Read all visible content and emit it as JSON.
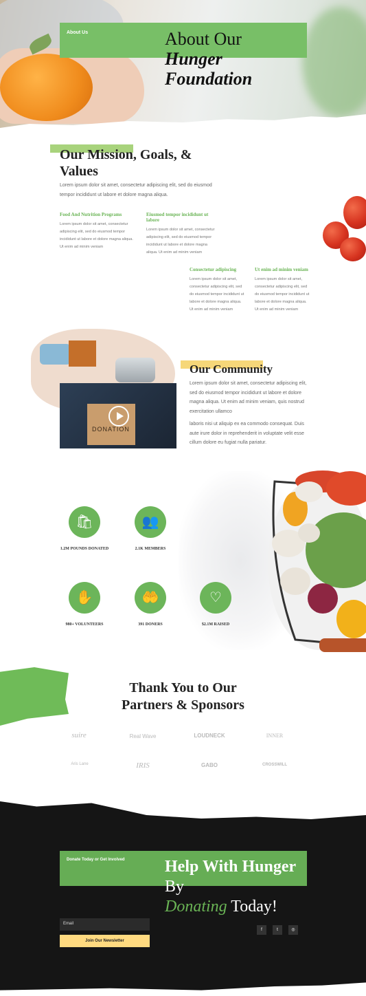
{
  "hero": {
    "kicker": "About Us",
    "title_line1": "About Our",
    "title_bold": "Hunger Foundation"
  },
  "mission": {
    "title": "Our Mission, Goals, & Values",
    "body": "Lorem ipsum dolor sit amet, consectetur adipiscing elit, sed do eiusmod tempor incididunt ut labore et dolore magna aliqua.",
    "columns": [
      {
        "heading": "Food And Nutrition Programs",
        "body": "Lorem ipsum dolor sit amet, consectetur adipiscing elit, sed do eiusmod tempor incididunt ut labore et dolore magna aliqua. Ut enim ad minim veniam"
      },
      {
        "heading": "Eiusmod tempor incididunt ut labore",
        "body": "Lorem ipsum dolor sit amet, consectetur adipiscing elit, sed do eiusmod tempor incididunt ut labore et dolore magna aliqua. Ut enim ad minim veniam"
      },
      {
        "heading": "Consectetur adipiscing",
        "body": "Lorem ipsum dolor sit amet, consectetur adipiscing elit, sed do eiusmod tempor incididunt ut labore et dolore magna aliqua. Ut enim ad minim veniam"
      },
      {
        "heading": "Ut enim ad minim veniam",
        "body": "Lorem ipsum dolor sit amet, consectetur adipiscing elit, sed do eiusmod tempor incididunt ut labore et dolore magna aliqua. Ut enim ad minim veniam"
      }
    ]
  },
  "community": {
    "title": "Our Community",
    "p1": "Lorem ipsum dolor sit amet, consectetur adipiscing elit, sed do eiusmod tempor incididunt ut labore et dolore magna aliqua. Ut enim ad minim veniam, quis nostrud exercitation ullamco",
    "p2": "laboris nisi ut aliquip ex ea commodo consequat. Duis aute irure dolor in reprehenderit in voluptate velit esse cillum dolore eu fugiat nulla pariatur.",
    "video_box_label": "DONATION"
  },
  "stats": [
    {
      "icon": "bag-icon",
      "glyph": "🛍",
      "label": "1.2M POUNDS DONATED"
    },
    {
      "icon": "members-icon",
      "glyph": "👥",
      "label": "2.1K MEMBERS"
    },
    {
      "icon": "raised-hand-icon",
      "glyph": "✋",
      "label": "980+ VOLUNTEERS"
    },
    {
      "icon": "heart-hand-icon",
      "glyph": "🤲",
      "label": "391 DONERS"
    },
    {
      "icon": "heart-icon",
      "glyph": "♡",
      "label": "$2.1M RAISED"
    }
  ],
  "partners": {
    "title": "Thank You to Our Partners & Sponsors",
    "logos": [
      "suire",
      "Real Wave",
      "LOUDNECK",
      "INNER",
      "Aris Lane",
      "IRIS",
      "GABO",
      "CROSSWILL"
    ]
  },
  "footer": {
    "kicker": "Donate Today or Get Involved",
    "title_bold": "Help With Hunger",
    "title_by": " By",
    "title_green": "Donating",
    "title_end": " Today!",
    "email_placeholder": "Email",
    "newsletter_label": "Join Our Newsletter",
    "social": [
      {
        "icon": "facebook-icon",
        "glyph": "f"
      },
      {
        "icon": "twitter-icon",
        "glyph": "t"
      },
      {
        "icon": "instagram-icon",
        "glyph": "◎"
      }
    ]
  },
  "colors": {
    "accent_green": "#78bf67",
    "accent_yellow": "#ffda80",
    "dark": "#151515"
  }
}
